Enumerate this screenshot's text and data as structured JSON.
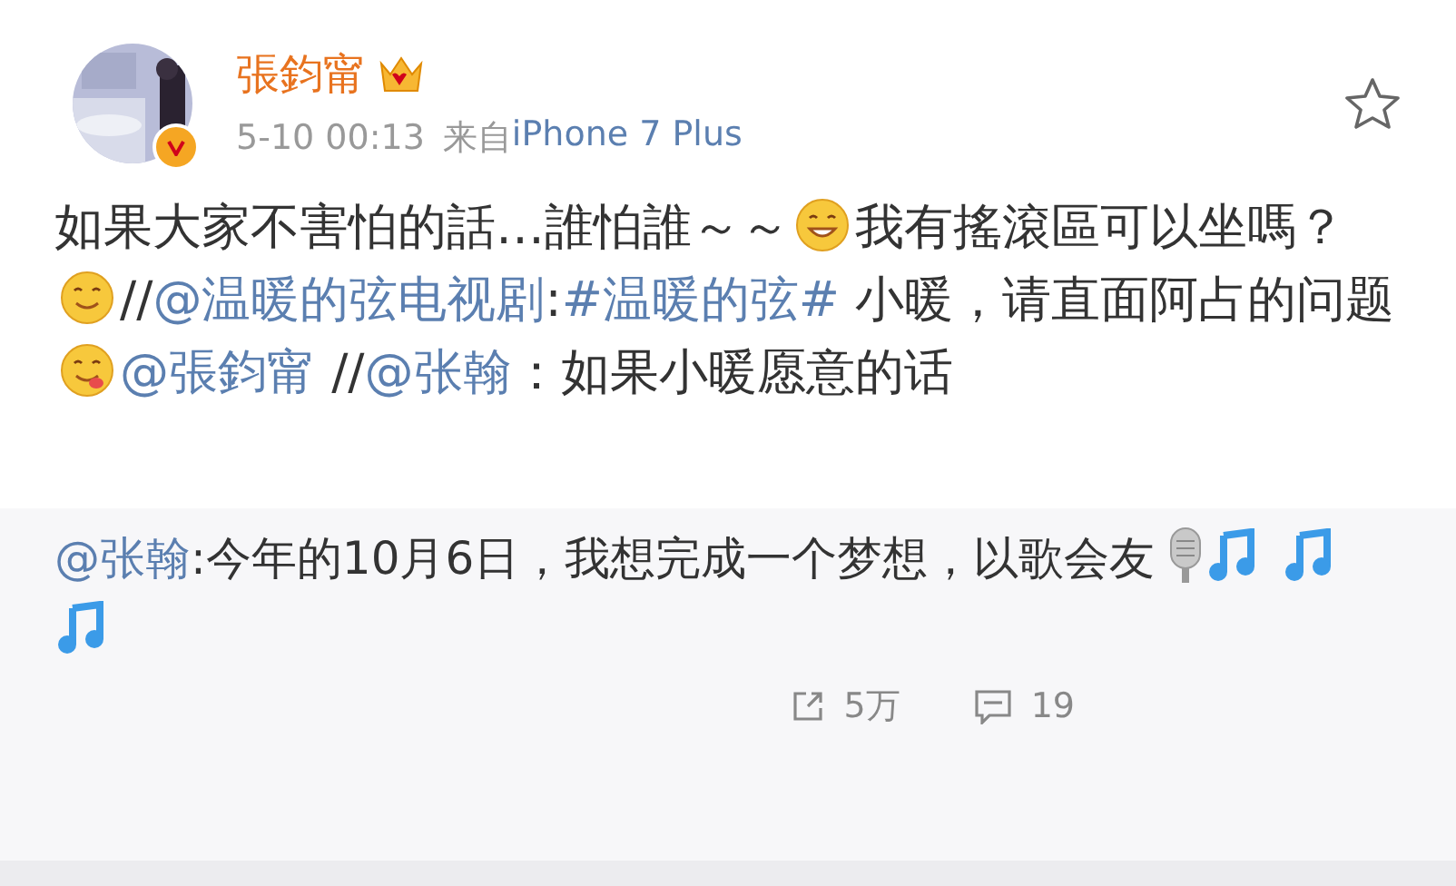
{
  "author": {
    "name": "張鈞甯",
    "verified": true,
    "vip": true
  },
  "meta": {
    "time": "5-10 00:13",
    "from_label": "来自",
    "device": "iPhone 7 Plus"
  },
  "favorited": false,
  "body": [
    {
      "kind": "text",
      "text": "如果大家不害怕的話…誰怕誰～～"
    },
    {
      "kind": "emoji"
    },
    {
      "kind": "text",
      "text": "我有搖滾區可以坐嗎？ "
    },
    {
      "kind": "emoji"
    },
    {
      "kind": "text",
      "text": "//"
    },
    {
      "kind": "link",
      "text": "@温暖的弦电视剧"
    },
    {
      "kind": "text",
      "text": ":"
    },
    {
      "kind": "link",
      "text": "#温暖的弦#"
    },
    {
      "kind": "text",
      "text": " 小暖，请直面阿占的问题"
    },
    {
      "kind": "emoji"
    },
    {
      "kind": "link",
      "text": "@張鈞甯"
    },
    {
      "kind": "text",
      "text": " //"
    },
    {
      "kind": "link",
      "text": "@张翰"
    },
    {
      "kind": "text",
      "text": "：如果小暖愿意的话"
    }
  ],
  "repost": {
    "body": [
      {
        "kind": "link",
        "text": "@张翰"
      },
      {
        "kind": "text",
        "text": ":今年的10月6日，我想完成一个梦想，以歌会友"
      },
      {
        "kind": "mic"
      },
      {
        "kind": "note"
      },
      {
        "kind": "note"
      },
      {
        "kind": "note"
      }
    ],
    "actions": [
      {
        "kind": "share",
        "count": "5万"
      },
      {
        "kind": "comment",
        "count": "19"
      }
    ]
  }
}
